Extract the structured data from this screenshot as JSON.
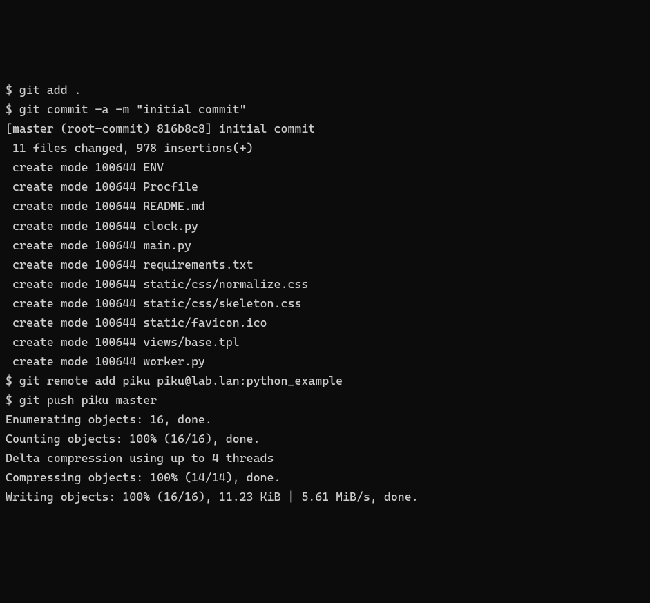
{
  "terminal": {
    "lines": [
      "$ git add .",
      "$ git commit -a -m \"initial commit\"",
      "[master (root-commit) 816b8c8] initial commit",
      " 11 files changed, 978 insertions(+)",
      " create mode 100644 ENV",
      " create mode 100644 Procfile",
      " create mode 100644 README.md",
      " create mode 100644 clock.py",
      " create mode 100644 main.py",
      " create mode 100644 requirements.txt",
      " create mode 100644 static/css/normalize.css",
      " create mode 100644 static/css/skeleton.css",
      " create mode 100644 static/favicon.ico",
      " create mode 100644 views/base.tpl",
      " create mode 100644 worker.py",
      "$ git remote add piku piku@lab.lan:python_example",
      "$ git push piku master",
      "Enumerating objects: 16, done.",
      "Counting objects: 100% (16/16), done.",
      "Delta compression using up to 4 threads",
      "Compressing objects: 100% (14/14), done.",
      "Writing objects: 100% (16/16), 11.23 KiB | 5.61 MiB/s, done."
    ]
  }
}
